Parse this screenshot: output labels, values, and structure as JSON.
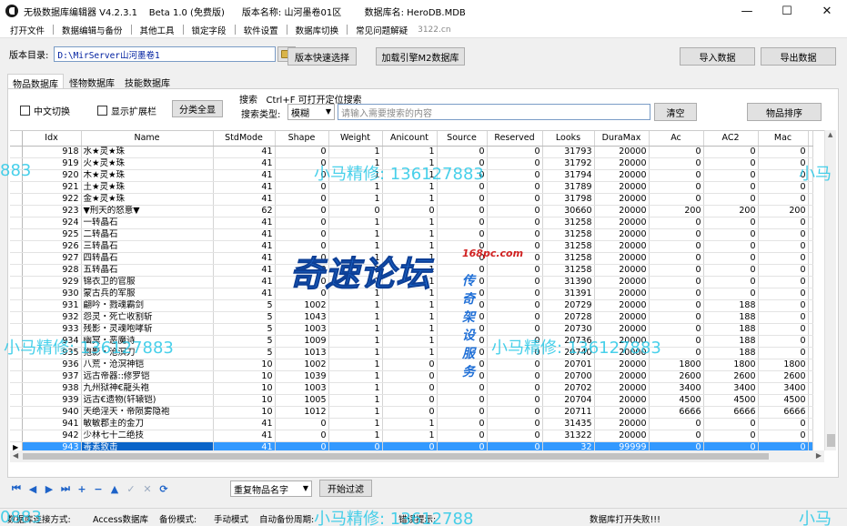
{
  "window": {
    "title": "无极数据库编辑器 V4.2.3.1    Beta 1.0 (免费版)      版本名称: 山河墨卷01区        数据库名: HeroDB.MDB",
    "controls": [
      "minimize",
      "maximize",
      "close"
    ]
  },
  "menu": {
    "items": [
      "打开文件",
      "数据编辑与备份",
      "其他工具",
      "锁定字段",
      "软件设置",
      "数据库切换",
      "常见问题解疑"
    ],
    "extra": "3122.cn"
  },
  "dir": {
    "label": "版本目录:",
    "value": "D:\\MirServer山河墨卷1"
  },
  "buttons": {
    "quick_select": "版本快速选择",
    "load_m2": "加载引擎M2数据库",
    "import": "导入数据",
    "export": "导出数据",
    "categorize": "分类全显",
    "clear": "清空",
    "sort": "物品排序",
    "start_filter": "开始过滤"
  },
  "tabs": [
    "物品数据库",
    "怪物数据库",
    "技能数据库"
  ],
  "filters": {
    "chinese_toggle": "中文切换",
    "show_extended": "显示扩展栏",
    "search_hint": "搜索   Ctrl+F 可打开定位搜索",
    "search_type_label": "搜索类型:",
    "search_type_value": "模糊",
    "search_placeholder": "请输入需要搜索的内容"
  },
  "grid": {
    "columns": [
      "Idx",
      "Name",
      "StdMode",
      "Shape",
      "Weight",
      "Anicount",
      "Source",
      "Reserved",
      "Looks",
      "DuraMax",
      "Ac",
      "AC2",
      "Mac"
    ],
    "rows": [
      [
        "918",
        "水★灵★珠",
        "41",
        "0",
        "1",
        "1",
        "0",
        "0",
        "31793",
        "20000",
        "0",
        "0",
        "0"
      ],
      [
        "919",
        "火★灵★珠",
        "41",
        "0",
        "1",
        "1",
        "0",
        "0",
        "31792",
        "20000",
        "0",
        "0",
        "0"
      ],
      [
        "920",
        "木★灵★珠",
        "41",
        "0",
        "1",
        "1",
        "0",
        "0",
        "31794",
        "20000",
        "0",
        "0",
        "0"
      ],
      [
        "921",
        "土★灵★珠",
        "41",
        "0",
        "1",
        "1",
        "0",
        "0",
        "31789",
        "20000",
        "0",
        "0",
        "0"
      ],
      [
        "922",
        "金★灵★珠",
        "41",
        "0",
        "1",
        "1",
        "0",
        "0",
        "31798",
        "20000",
        "0",
        "0",
        "0"
      ],
      [
        "923",
        "▼刑天的怒意▼",
        "62",
        "0",
        "0",
        "0",
        "0",
        "0",
        "30660",
        "20000",
        "200",
        "200",
        "200"
      ],
      [
        "924",
        "一转晶石",
        "41",
        "0",
        "1",
        "1",
        "0",
        "0",
        "31258",
        "20000",
        "0",
        "0",
        "0"
      ],
      [
        "925",
        "二转晶石",
        "41",
        "0",
        "1",
        "1",
        "0",
        "0",
        "31258",
        "20000",
        "0",
        "0",
        "0"
      ],
      [
        "926",
        "三转晶石",
        "41",
        "0",
        "1",
        "1",
        "0",
        "0",
        "31258",
        "20000",
        "0",
        "0",
        "0"
      ],
      [
        "927",
        "四转晶石",
        "41",
        "0",
        "1",
        "1",
        "0",
        "0",
        "31258",
        "20000",
        "0",
        "0",
        "0"
      ],
      [
        "928",
        "五转晶石",
        "41",
        "0",
        "1",
        "1",
        "0",
        "0",
        "31258",
        "20000",
        "0",
        "0",
        "0"
      ],
      [
        "929",
        "锦衣卫的官服",
        "41",
        "0",
        "1",
        "1",
        "0",
        "0",
        "31390",
        "20000",
        "0",
        "0",
        "0"
      ],
      [
        "930",
        "蒙古兵的军服",
        "41",
        "0",
        "1",
        "1",
        "0",
        "0",
        "31391",
        "20000",
        "0",
        "0",
        "0"
      ],
      [
        "931",
        "翩吟・戮魂霸剑",
        "5",
        "1002",
        "1",
        "1",
        "0",
        "0",
        "20729",
        "20000",
        "0",
        "188",
        "0"
      ],
      [
        "932",
        "怨灵・死亡收割斩",
        "5",
        "1043",
        "1",
        "1",
        "0",
        "0",
        "20728",
        "20000",
        "0",
        "188",
        "0"
      ],
      [
        "933",
        "残影・灵魂咆哮斩",
        "5",
        "1003",
        "1",
        "1",
        "0",
        "0",
        "20730",
        "20000",
        "0",
        "188",
        "0"
      ],
      [
        "934",
        "幽冥・恶魔诗",
        "5",
        "1009",
        "1",
        "1",
        "0",
        "0",
        "20736",
        "20000",
        "0",
        "188",
        "0"
      ],
      [
        "935",
        "狍影・沧溟刀",
        "5",
        "1013",
        "1",
        "1",
        "0",
        "0",
        "20740",
        "20000",
        "0",
        "188",
        "0"
      ],
      [
        "936",
        "八荒・沧溟神铠",
        "10",
        "1002",
        "1",
        "0",
        "0",
        "0",
        "20701",
        "20000",
        "1800",
        "1800",
        "1800"
      ],
      [
        "937",
        "远古帝器::修罗铠",
        "10",
        "1039",
        "1",
        "0",
        "0",
        "0",
        "20700",
        "20000",
        "2600",
        "2600",
        "2600"
      ],
      [
        "938",
        "九州狱神€龍头袍",
        "10",
        "1003",
        "1",
        "0",
        "0",
        "0",
        "20702",
        "20000",
        "3400",
        "3400",
        "3400"
      ],
      [
        "939",
        "远古€遗物(轩辕铠)",
        "10",
        "1005",
        "1",
        "0",
        "0",
        "0",
        "20704",
        "20000",
        "4500",
        "4500",
        "4500"
      ],
      [
        "940",
        "天绝淫天・帝陨雾隐袍",
        "10",
        "1012",
        "1",
        "0",
        "0",
        "0",
        "20711",
        "20000",
        "6666",
        "6666",
        "6666"
      ],
      [
        "941",
        "敏敏郡主的金刀",
        "41",
        "0",
        "1",
        "1",
        "0",
        "0",
        "31435",
        "20000",
        "0",
        "0",
        "0"
      ],
      [
        "942",
        "少林七十二绝技",
        "41",
        "0",
        "1",
        "1",
        "0",
        "0",
        "31322",
        "20000",
        "0",
        "0",
        "0"
      ],
      [
        "943",
        "毒素致击",
        "41",
        "0",
        "0",
        "0",
        "0",
        "0",
        "32",
        "99999",
        "0",
        "0",
        "0"
      ]
    ],
    "selected_index": 25
  },
  "nav": {
    "icons": [
      "first-icon",
      "prev-icon",
      "next-icon",
      "last-icon",
      "add-icon",
      "delete-icon",
      "up-icon",
      "confirm-icon",
      "cancel-icon",
      "refresh-icon"
    ],
    "filter_value": "重复物品名字"
  },
  "status": {
    "connection_label": "数据库连接方式:",
    "connection_value": "Access数据库",
    "backup_label": "备份模式:",
    "backup_value": "手动模式",
    "auto_backup_label": "自动备份周期:",
    "error_label": "错误提示:",
    "message": "数据库打开失败!!!"
  },
  "watermarks": {
    "text": "小马精修: 13612788",
    "text2": "小马精修: 136127883",
    "logo": "奇速论坛",
    "logo_url": "168pc.com",
    "logo_sub": "传奇架设服务",
    "edge": "883",
    "corner": "小马",
    "bottom_left": "0883"
  },
  "colors": {
    "selection": "#3399ff",
    "watermark": "#28c8e6",
    "logo": "#1f6fd6"
  }
}
